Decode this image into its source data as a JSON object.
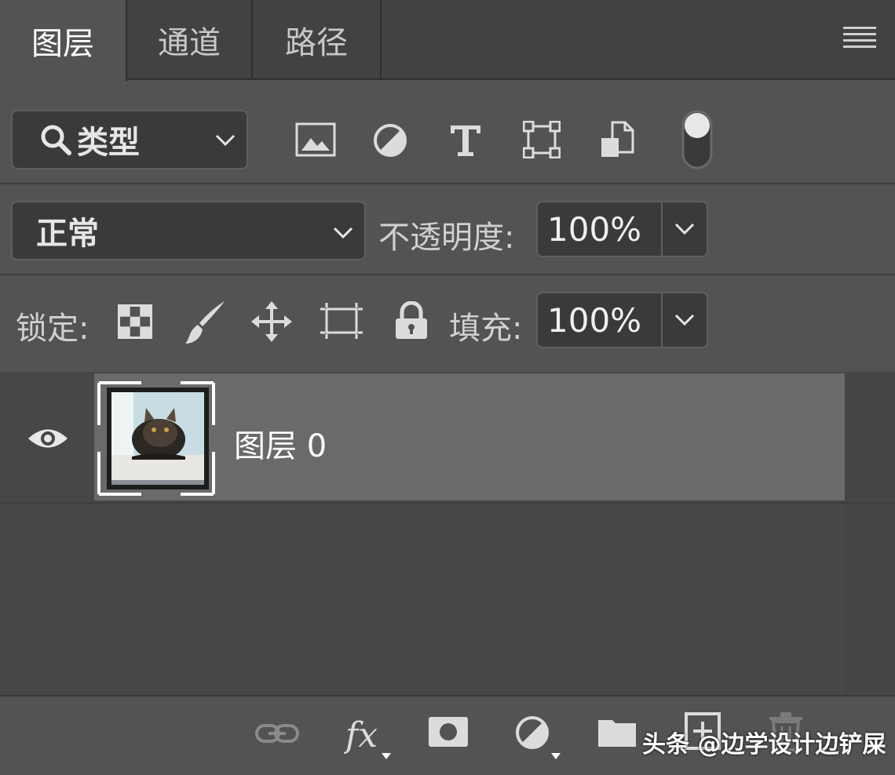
{
  "tabs": [
    "图层",
    "通道",
    "路径"
  ],
  "filter": {
    "label": "类型"
  },
  "blend": {
    "mode": "正常",
    "opacity_label": "不透明度:",
    "opacity_value": "100%"
  },
  "lock": {
    "label": "锁定:",
    "fill_label": "填充:",
    "fill_value": "100%"
  },
  "layers": [
    {
      "name": "图层 0"
    }
  ],
  "watermark": "头条 @边学设计边铲屎"
}
